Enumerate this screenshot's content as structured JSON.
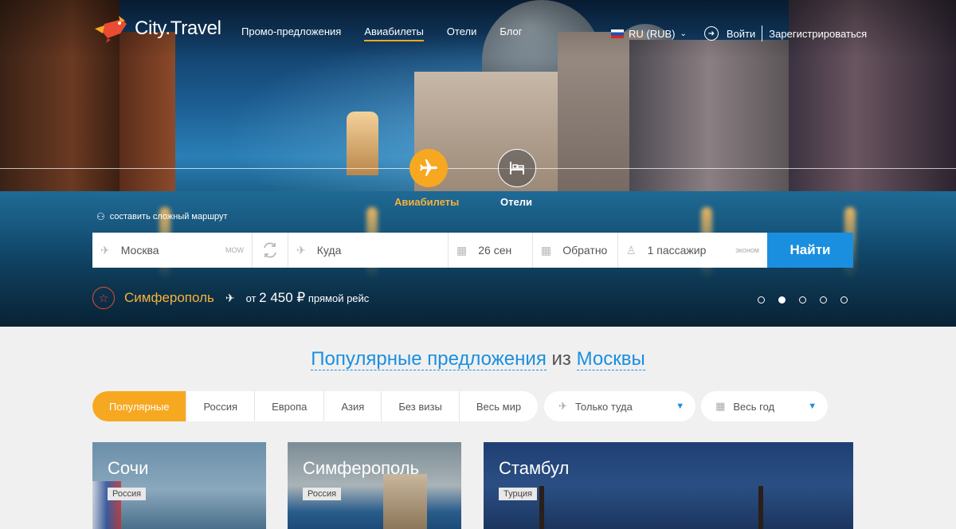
{
  "header": {
    "logo_text": "City.Travel",
    "nav": [
      "Промо-предложения",
      "Авиабилеты",
      "Отели",
      "Блог"
    ],
    "active_nav": "Авиабилеты",
    "currency": "RU (RUB)",
    "login": "Войти",
    "register": "Зарегистрироваться"
  },
  "hero": {
    "tab_air": "Авиабилеты",
    "tab_hotel": "Отели",
    "complex_route": "составить сложный маршрут"
  },
  "search": {
    "from": "Москва",
    "from_code": "MOW",
    "to_placeholder": "Куда",
    "date": "26 сен",
    "return_placeholder": "Обратно",
    "passengers": "1 пассажир",
    "class": "эконом",
    "find_button": "Найти"
  },
  "promo": {
    "city": "Симферополь",
    "price_prefix": "от",
    "price": "2 450 ₽",
    "flight_type": "прямой рейс",
    "slides_total": 5,
    "slide_active": 2
  },
  "popular": {
    "title_part1": "Популярные предложения",
    "title_part2": "из",
    "title_part3": "Москвы",
    "tabs": [
      "Популярные",
      "Россия",
      "Европа",
      "Азия",
      "Без визы",
      "Весь мир"
    ],
    "active_tab": "Популярные",
    "direction": "Только туда",
    "period": "Весь год",
    "cards": [
      {
        "city": "Сочи",
        "country": "Россия"
      },
      {
        "city": "Симферополь",
        "country": "Россия"
      },
      {
        "city": "Стамбул",
        "country": "Турция"
      }
    ]
  },
  "colors": {
    "accent_orange": "#f7a821",
    "accent_blue": "#1a8fe0",
    "promo_red": "#e94b35"
  }
}
